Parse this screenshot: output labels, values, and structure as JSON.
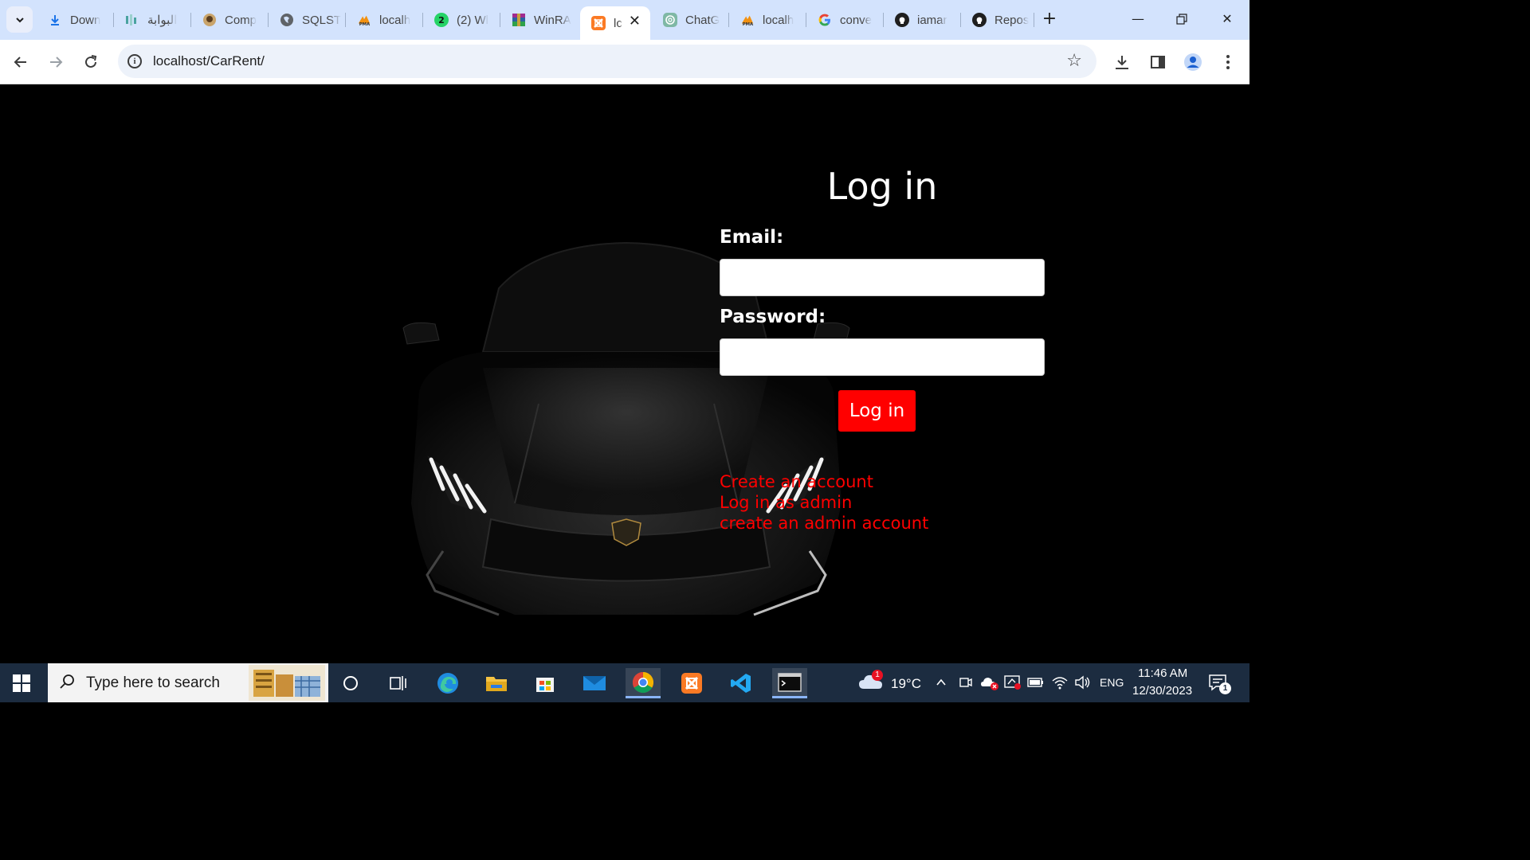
{
  "browser": {
    "tabs": [
      {
        "title": "Down",
        "icon": "download-icon"
      },
      {
        "title": "البوابة",
        "icon": "portal-icon"
      },
      {
        "title": "Comp",
        "icon": "comp-icon"
      },
      {
        "title": "SQLST",
        "icon": "globe-icon"
      },
      {
        "title": "localh",
        "icon": "phpmyadmin-icon"
      },
      {
        "title": "(2) Wl",
        "icon": "whatsapp-icon"
      },
      {
        "title": "WinRA",
        "icon": "winrar-icon"
      },
      {
        "title": "lc",
        "icon": "xampp-icon",
        "active": true
      },
      {
        "title": "ChatG",
        "icon": "chatgpt-icon"
      },
      {
        "title": "localh",
        "icon": "phpmyadmin-icon"
      },
      {
        "title": "conve",
        "icon": "google-icon"
      },
      {
        "title": "iamar",
        "icon": "github-icon"
      },
      {
        "title": "Repos",
        "icon": "github-icon"
      }
    ],
    "url": "localhost/CarRent/"
  },
  "page": {
    "title": "Log in",
    "email_label": "Email:",
    "email_value": "",
    "password_label": "Password:",
    "password_value": "",
    "login_button": "Log in",
    "links": {
      "create_account": "Create an account",
      "admin_login": "Log in as admin",
      "create_admin": "create an admin account"
    },
    "accent_color": "#ff0000"
  },
  "taskbar": {
    "search_placeholder": "Type here to search",
    "weather_temp": "19°C",
    "weather_badge": "1",
    "language": "ENG",
    "time": "11:46 AM",
    "date": "12/30/2023",
    "notification_count": "1"
  }
}
